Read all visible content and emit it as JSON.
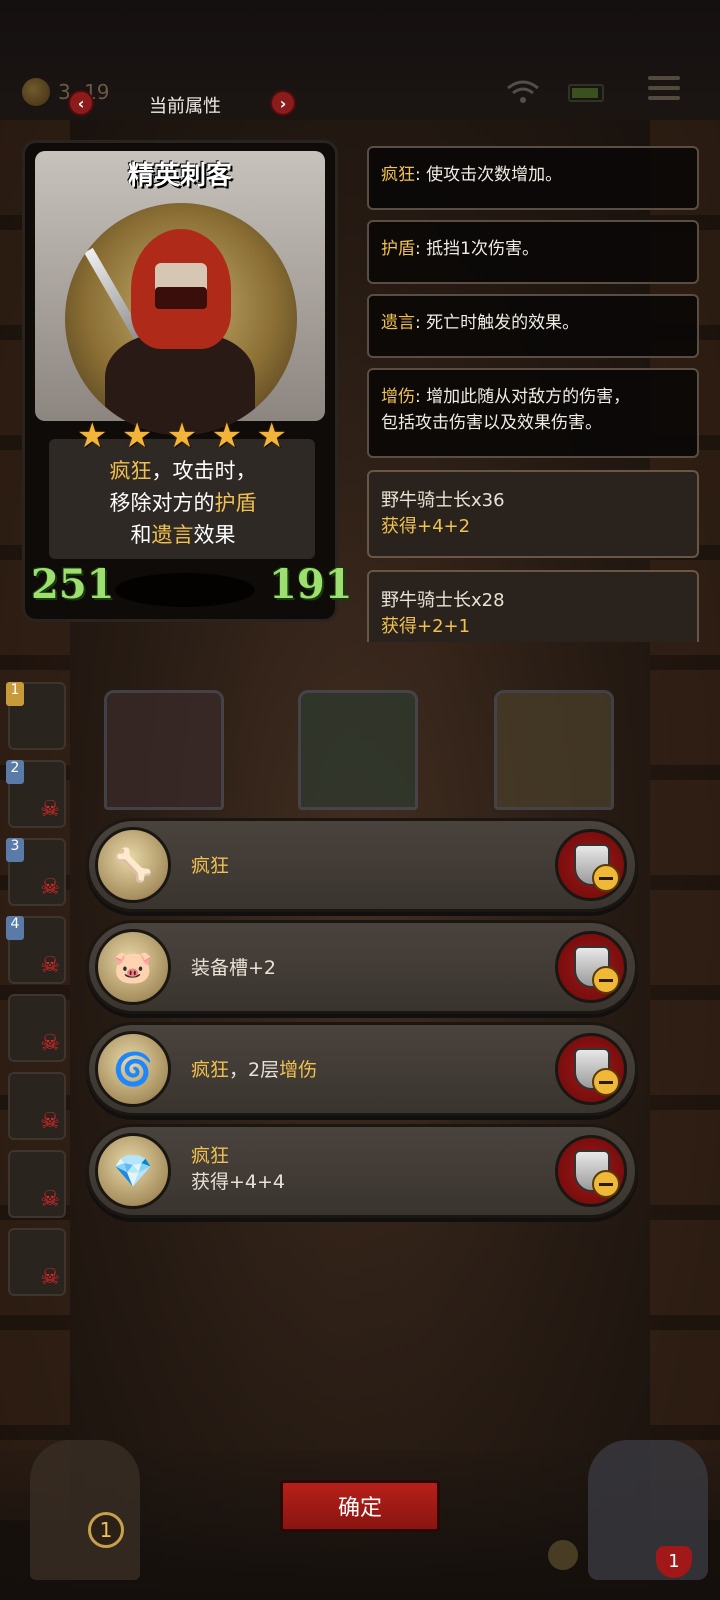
{
  "header": {
    "title": "当前属性",
    "coin_count": "3‥19",
    "prev_icon": "chevron-left-icon",
    "next_icon": "chevron-right-icon"
  },
  "card": {
    "name": "精英刺客",
    "stars": 5,
    "desc_line1_kw": "疯狂",
    "desc_line1_rest": "，攻击时，",
    "desc_line2_pre": "移除对方的",
    "desc_line2_kw": "护盾",
    "desc_line3_pre": "和",
    "desc_line3_kw": "遗言",
    "desc_line3_post": "效果",
    "attack": "251",
    "health": "191"
  },
  "keywords": [
    {
      "kw": "疯狂",
      "text": ": 使攻击次数增加。"
    },
    {
      "kw": "护盾",
      "text": ": 抵挡1次伤害。"
    },
    {
      "kw": "遗言",
      "text": ": 死亡时触发的效果。"
    },
    {
      "kw": "增伤",
      "text": ": 增加此随从对敌方的伤害，",
      "line2": "包括攻击伤害以及效果伤害。"
    }
  ],
  "minions": [
    {
      "name": "野牛骑士长x36",
      "gain": "获得+4+2"
    },
    {
      "name": "野牛骑士长x28",
      "gain": "获得+2+1"
    }
  ],
  "side_slots": [
    "1",
    "2",
    "3",
    "4"
  ],
  "equipment": [
    {
      "kw": "疯狂",
      "rest": "",
      "icon": "claw-icon"
    },
    {
      "kw": "",
      "rest": "装备槽+2",
      "icon": "pig-icon"
    },
    {
      "kw": "疯狂",
      "rest": "，2层",
      "kw2": "增伤",
      "icon": "wind-icon"
    },
    {
      "kw": "疯狂",
      "sub": "获得+4+4",
      "icon": "crystal-icon"
    }
  ],
  "footer": {
    "confirm_label": "确定",
    "chest_count": "1",
    "heart_count": "1"
  },
  "colors": {
    "keyword": "#f0c050",
    "stat_green": "#9ee070",
    "button_red": "#a01818"
  }
}
